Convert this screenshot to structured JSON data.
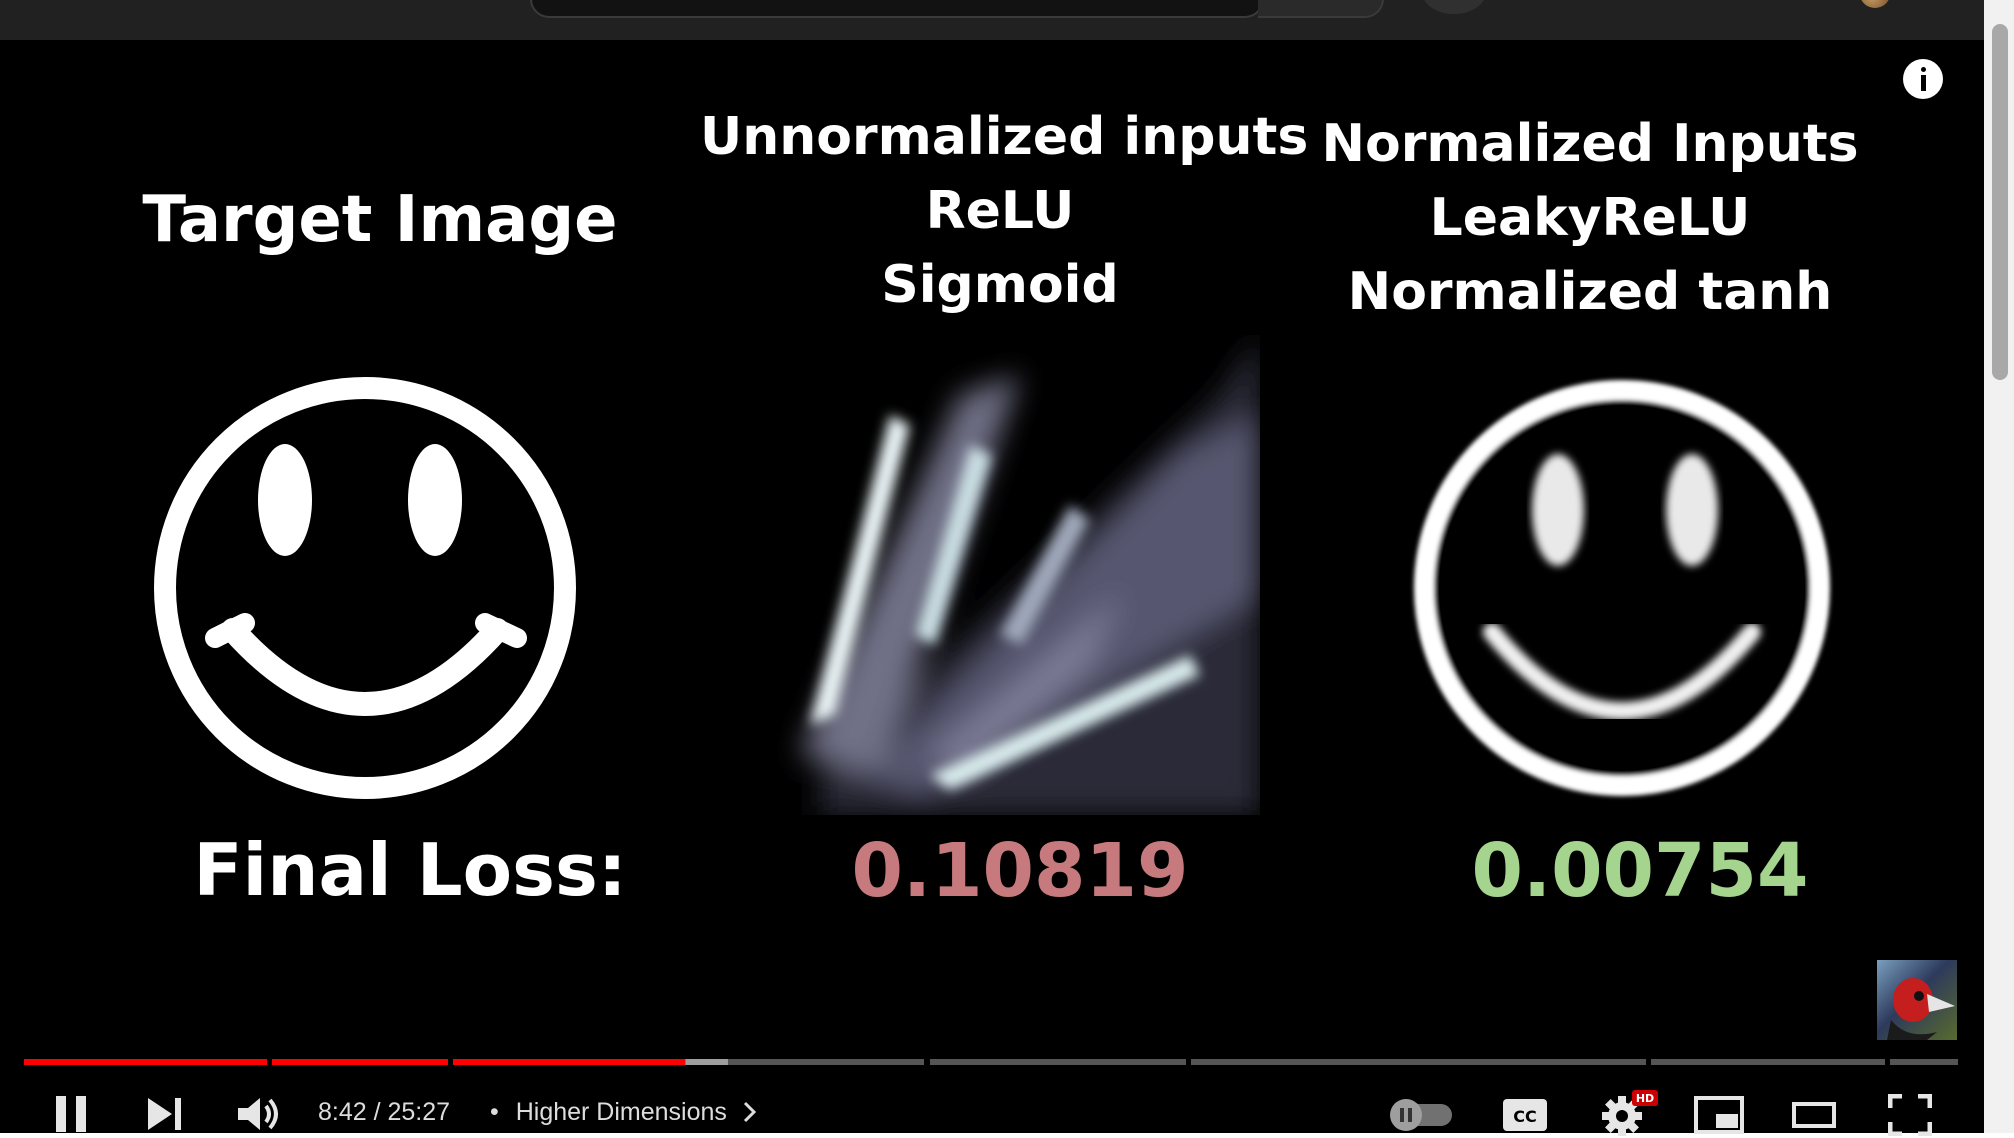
{
  "slide": {
    "col1_title": "Target Image",
    "col2_title_lines": [
      "Unnormalized inputs",
      "ReLU",
      "Sigmoid"
    ],
    "col3_title_lines": [
      "Normalized Inputs",
      "LeakyReLU",
      "Normalized tanh"
    ],
    "loss_label": "Final Loss:",
    "loss_values": [
      "0.10819",
      "0.00754"
    ]
  },
  "player": {
    "time": "8:42 / 25:27",
    "separator": "•",
    "chapter": "Higher Dimensions",
    "hd_badge": "HD",
    "played_fraction": 0.342,
    "buffered_fraction": 0.364,
    "icons": [
      "pause-icon",
      "next-icon",
      "volume-icon",
      "chevron-right-icon",
      "autoplay-toggle-icon",
      "cc-icon",
      "settings-icon",
      "miniplayer-icon",
      "theater-icon",
      "fullscreen-icon",
      "info-icon"
    ],
    "colors": {
      "played": "#ff0000",
      "buffered": "#9e9e9e",
      "track": "#555555",
      "loss_bad": "#c77a7d",
      "loss_good": "#a5d48e"
    }
  }
}
